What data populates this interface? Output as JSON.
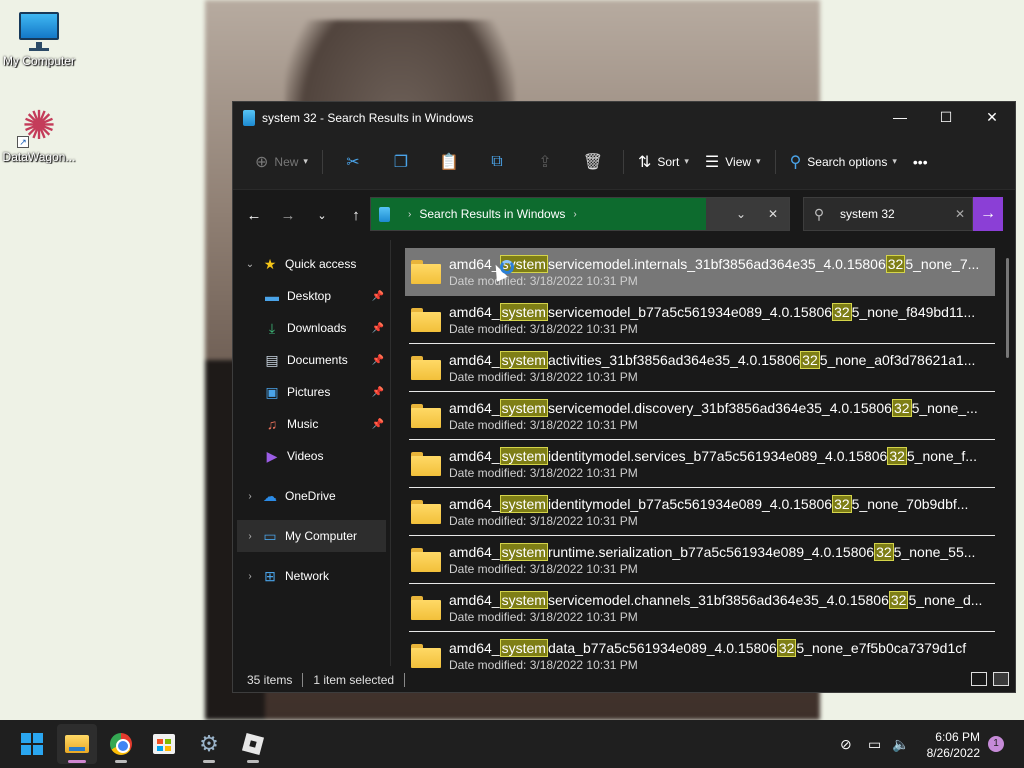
{
  "desktop": {
    "icons": [
      {
        "label": "My Computer",
        "icon": "monitor-icon"
      },
      {
        "label": "DataWagon...",
        "icon": "datawagon-icon"
      }
    ]
  },
  "window": {
    "title": "system 32 - Search Results in Windows",
    "controls": {
      "minimize": "—",
      "maximize": "☐",
      "close": "✕"
    }
  },
  "toolbar": {
    "new_label": "New",
    "sort_label": "Sort",
    "view_label": "View",
    "search_options_label": "Search options",
    "more_label": "•••"
  },
  "address": {
    "location": "Search Results in Windows",
    "search_value": "system 32"
  },
  "sidebar": {
    "quick_access": "Quick access",
    "items": [
      {
        "label": "Desktop",
        "icon": "desktop-icon",
        "pinned": true
      },
      {
        "label": "Downloads",
        "icon": "downloads-icon",
        "pinned": true
      },
      {
        "label": "Documents",
        "icon": "documents-icon",
        "pinned": true
      },
      {
        "label": "Pictures",
        "icon": "pictures-icon",
        "pinned": true
      },
      {
        "label": "Music",
        "icon": "music-icon",
        "pinned": true
      },
      {
        "label": "Videos",
        "icon": "videos-icon",
        "pinned": false
      }
    ],
    "onedrive": "OneDrive",
    "my_computer": "My Computer",
    "network": "Network"
  },
  "results": {
    "highlight_term": "system",
    "highlight_num": "32",
    "date_label": "Date modified: 3/18/2022 10:31 PM",
    "rows": [
      {
        "prefix": "amd64_",
        "mid": "servicemodel.internals_31bf3856ad364e35_4.0.15806",
        "suffix": "5_none_7...",
        "selected": true
      },
      {
        "prefix": "amd64_",
        "mid": "servicemodel_b77a5c561934e089_4.0.15806",
        "suffix": "5_none_f849bd11...",
        "selected": false
      },
      {
        "prefix": "amd64_",
        "mid": "activities_31bf3856ad364e35_4.0.15806",
        "suffix": "5_none_a0f3d78621a1...",
        "selected": false
      },
      {
        "prefix": "amd64_",
        "mid": "servicemodel.discovery_31bf3856ad364e35_4.0.15806",
        "suffix": "5_none_...",
        "selected": false
      },
      {
        "prefix": "amd64_",
        "mid": "identitymodel.services_b77a5c561934e089_4.0.15806",
        "suffix": "5_none_f...",
        "selected": false
      },
      {
        "prefix": "amd64_",
        "mid": "identitymodel_b77a5c561934e089_4.0.15806",
        "suffix": "5_none_70b9dbf...",
        "selected": false
      },
      {
        "prefix": "amd64_",
        "mid": "runtime.serialization_b77a5c561934e089_4.0.15806",
        "suffix": "5_none_55...",
        "selected": false
      },
      {
        "prefix": "amd64_",
        "mid": "servicemodel.channels_31bf3856ad364e35_4.0.15806",
        "suffix": "5_none_d...",
        "selected": false
      },
      {
        "prefix": "amd64_",
        "mid": "data_b77a5c561934e089_4.0.15806",
        "suffix": "5_none_e7f5b0ca7379d1cf",
        "selected": false
      }
    ]
  },
  "status": {
    "items_count": "35 items",
    "selected": "1 item selected"
  },
  "taskbar": {
    "time": "6:06 PM",
    "date": "8/26/2022",
    "notifications": "1"
  }
}
